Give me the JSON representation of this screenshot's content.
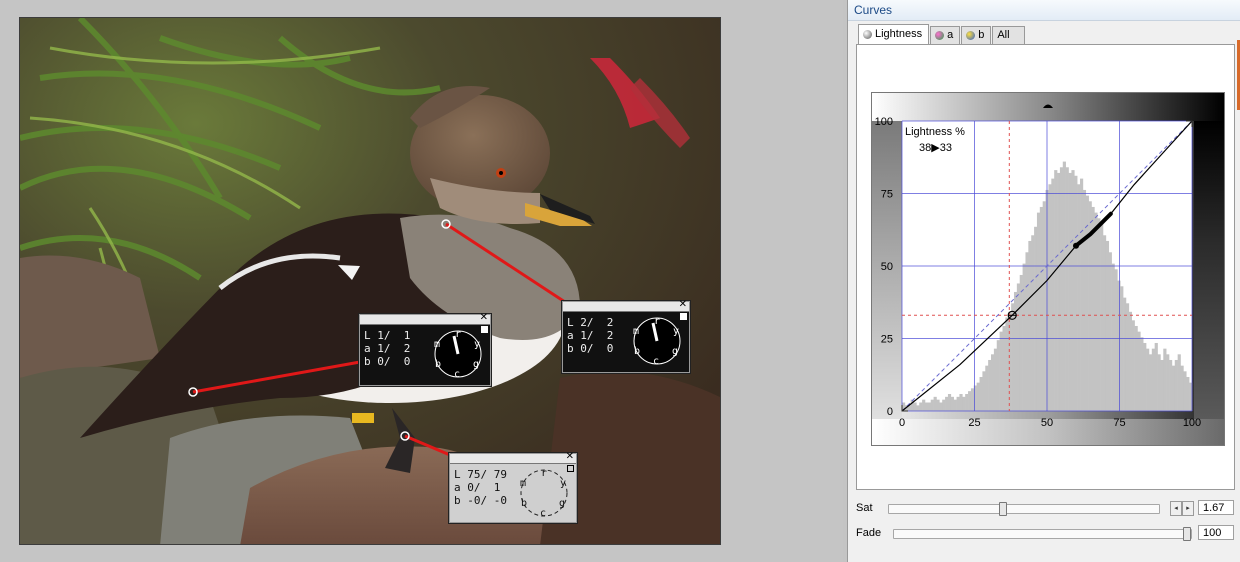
{
  "panel": {
    "title": "Curves",
    "tabs": [
      {
        "label": "Lightness",
        "icon": "lightness-ball-icon",
        "active": true
      },
      {
        "label": "a",
        "icon": "a-channel-ball-icon"
      },
      {
        "label": "b",
        "icon": "b-channel-ball-icon"
      },
      {
        "label": "All"
      }
    ]
  },
  "samplers": [
    {
      "L": "1/  1",
      "a": "1/  2",
      "b": "0/  0"
    },
    {
      "L": "2/  2",
      "a": "1/  2",
      "b": "0/  0"
    },
    {
      "L": "75/ 79",
      "a": "0/  1",
      "b": "-0/ -0"
    }
  ],
  "dial_letters": {
    "m": "m",
    "r": "r",
    "y": "y",
    "b": "b",
    "c": "c",
    "g": "g"
  },
  "chart_data": {
    "type": "line",
    "title": "Lightness %",
    "readout": "38▶33",
    "x_ticks": [
      "0",
      "25",
      "50",
      "75",
      "100"
    ],
    "y_ticks": [
      "0",
      "25",
      "50",
      "75",
      "100"
    ],
    "xlim": [
      0,
      100
    ],
    "ylim": [
      0,
      100
    ],
    "grid": true,
    "series": [
      {
        "name": "curve",
        "x": [
          0,
          20,
          38,
          50,
          60,
          65,
          72,
          80,
          90,
          100
        ],
        "y": [
          0,
          16,
          33,
          45,
          57,
          61,
          68,
          78,
          89,
          100
        ]
      },
      {
        "name": "",
        "x": [
          0,
          100
        ],
        "y": [
          0,
          100
        ]
      }
    ],
    "control_point": {
      "x": 38,
      "y": 33
    },
    "cursor_lines": {
      "x": 37,
      "y": 33
    },
    "histogram": [
      3,
      2,
      2,
      4,
      3,
      2,
      3,
      4,
      3,
      3,
      4,
      5,
      4,
      3,
      4,
      5,
      6,
      5,
      4,
      5,
      6,
      5,
      6,
      7,
      8,
      9,
      10,
      12,
      14,
      16,
      18,
      20,
      22,
      25,
      28,
      30,
      33,
      35,
      38,
      42,
      45,
      48,
      52,
      56,
      60,
      62,
      65,
      70,
      72,
      74,
      78,
      80,
      82,
      85,
      84,
      86,
      88,
      86,
      84,
      85,
      83,
      80,
      82,
      78,
      76,
      74,
      72,
      70,
      68,
      66,
      62,
      60,
      56,
      52,
      50,
      46,
      44,
      40,
      38,
      35,
      32,
      30,
      28,
      26,
      24,
      22,
      20,
      22,
      24,
      20,
      18,
      22,
      20,
      18,
      16,
      18,
      20,
      16,
      14,
      12,
      10
    ]
  },
  "sliders": {
    "sat": {
      "label": "Sat",
      "value": "1.67",
      "level": 0.42
    },
    "fade": {
      "label": "Fade",
      "value": "100",
      "level": 1.0
    }
  },
  "colors": {
    "accent": "#1c4a86",
    "sampler_line": "#e01818",
    "grid": "#4a4ad8"
  }
}
